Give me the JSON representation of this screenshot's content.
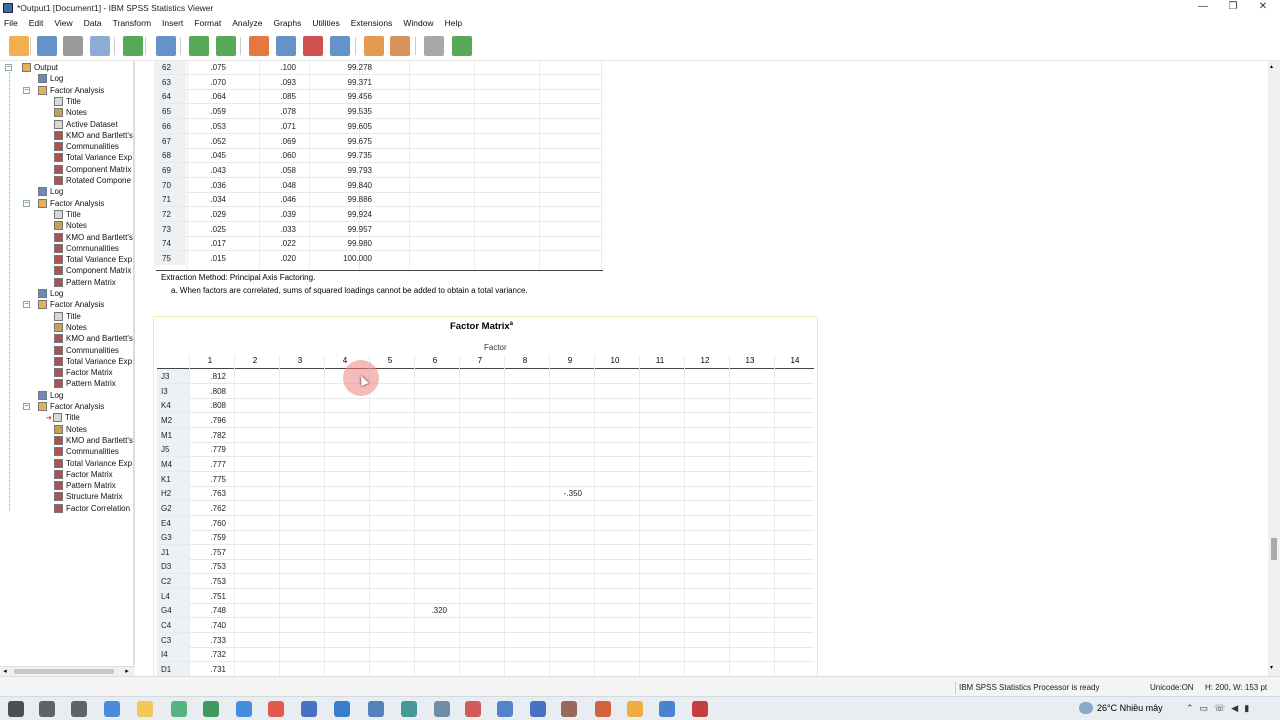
{
  "window": {
    "title": "*Output1 [Document1] - IBM SPSS Statistics Viewer",
    "minimize": "—",
    "restore": "❐",
    "close": "✕"
  },
  "menu": [
    "File",
    "Edit",
    "View",
    "Data",
    "Transform",
    "Insert",
    "Format",
    "Analyze",
    "Graphs",
    "Utilities",
    "Extensions",
    "Window",
    "Help"
  ],
  "toolbar": [
    "open-icon",
    "save-icon",
    "print-icon",
    "print-preview-icon",
    "export-icon",
    "recall-dialog-icon",
    "undo-icon",
    "redo-icon",
    "goto-data-icon",
    "goto-case-icon",
    "goto-variable-icon",
    "variables-icon",
    "insert-output-icon",
    "insert-item-icon",
    "disabled-icon",
    "add-icon"
  ],
  "tree": [
    {
      "label": "Output",
      "level": 0,
      "icon": "book"
    },
    {
      "label": "Log",
      "level": 1,
      "icon": "log"
    },
    {
      "label": "Factor Analysis",
      "level": 1,
      "icon": "book",
      "exp": "−"
    },
    {
      "label": "Title",
      "level": 2,
      "icon": "text"
    },
    {
      "label": "Notes",
      "level": 2,
      "icon": "note"
    },
    {
      "label": "Active Dataset",
      "level": 2,
      "icon": "text"
    },
    {
      "label": "KMO and Bartlett's",
      "level": 2,
      "icon": "table"
    },
    {
      "label": "Communalities",
      "level": 2,
      "icon": "table"
    },
    {
      "label": "Total Variance Exp",
      "level": 2,
      "icon": "table"
    },
    {
      "label": "Component Matrix",
      "level": 2,
      "icon": "table"
    },
    {
      "label": "Rotated Compone",
      "level": 2,
      "icon": "table"
    },
    {
      "label": "Log",
      "level": 1,
      "icon": "log"
    },
    {
      "label": "Factor Analysis",
      "level": 1,
      "icon": "book",
      "exp": "−"
    },
    {
      "label": "Title",
      "level": 2,
      "icon": "text"
    },
    {
      "label": "Notes",
      "level": 2,
      "icon": "note"
    },
    {
      "label": "KMO and Bartlett's",
      "level": 2,
      "icon": "table"
    },
    {
      "label": "Communalities",
      "level": 2,
      "icon": "table"
    },
    {
      "label": "Total Variance Exp",
      "level": 2,
      "icon": "table"
    },
    {
      "label": "Component Matrix",
      "level": 2,
      "icon": "table"
    },
    {
      "label": "Pattern Matrix",
      "level": 2,
      "icon": "table"
    },
    {
      "label": "Log",
      "level": 1,
      "icon": "log"
    },
    {
      "label": "Factor Analysis",
      "level": 1,
      "icon": "book",
      "exp": "−"
    },
    {
      "label": "Title",
      "level": 2,
      "icon": "text"
    },
    {
      "label": "Notes",
      "level": 2,
      "icon": "note"
    },
    {
      "label": "KMO and Bartlett's",
      "level": 2,
      "icon": "table"
    },
    {
      "label": "Communalities",
      "level": 2,
      "icon": "table"
    },
    {
      "label": "Total Variance Exp",
      "level": 2,
      "icon": "table"
    },
    {
      "label": "Factor Matrix",
      "level": 2,
      "icon": "table"
    },
    {
      "label": "Pattern Matrix",
      "level": 2,
      "icon": "table"
    },
    {
      "label": "Log",
      "level": 1,
      "icon": "log"
    },
    {
      "label": "Factor Analysis",
      "level": 1,
      "icon": "book",
      "exp": "−"
    },
    {
      "label": "Title",
      "level": 2,
      "icon": "text",
      "arrow": "➔"
    },
    {
      "label": "Notes",
      "level": 2,
      "icon": "note"
    },
    {
      "label": "KMO and Bartlett's",
      "level": 2,
      "icon": "table"
    },
    {
      "label": "Communalities",
      "level": 2,
      "icon": "table"
    },
    {
      "label": "Total Variance Exp",
      "level": 2,
      "icon": "table"
    },
    {
      "label": "Factor Matrix",
      "level": 2,
      "icon": "table"
    },
    {
      "label": "Pattern Matrix",
      "level": 2,
      "icon": "table"
    },
    {
      "label": "Structure Matrix",
      "level": 2,
      "icon": "table"
    },
    {
      "label": "Factor Correlation",
      "level": 2,
      "icon": "table"
    }
  ],
  "variance_rows": [
    [
      "62",
      ".075",
      ".100",
      "99.278"
    ],
    [
      "63",
      ".070",
      ".093",
      "99.371"
    ],
    [
      "64",
      ".064",
      ".085",
      "99.456"
    ],
    [
      "65",
      ".059",
      ".078",
      "99.535"
    ],
    [
      "66",
      ".053",
      ".071",
      "99.605"
    ],
    [
      "67",
      ".052",
      ".069",
      "99.675"
    ],
    [
      "68",
      ".045",
      ".060",
      "99.735"
    ],
    [
      "69",
      ".043",
      ".058",
      "99.793"
    ],
    [
      "70",
      ".036",
      ".048",
      "99.840"
    ],
    [
      "71",
      ".034",
      ".046",
      "99.886"
    ],
    [
      "72",
      ".029",
      ".039",
      "99.924"
    ],
    [
      "73",
      ".025",
      ".033",
      "99.957"
    ],
    [
      "74",
      ".017",
      ".022",
      "99.980"
    ],
    [
      "75",
      ".015",
      ".020",
      "100.000"
    ]
  ],
  "variance_footnote1": "Extraction Method: Principal Axis Factoring.",
  "variance_footnote2": "a. When factors are correlated, sums of squared loadings cannot be added to obtain a total variance.",
  "factor_matrix": {
    "title": "Factor Matrix",
    "title_sup": "a",
    "factor_header": "Factor",
    "columns": [
      "1",
      "2",
      "3",
      "4",
      "5",
      "6",
      "7",
      "8",
      "9",
      "10",
      "11",
      "12",
      "13",
      "14"
    ],
    "rows": [
      {
        "label": "J3",
        "c1": ".812"
      },
      {
        "label": "I3",
        "c1": ".808"
      },
      {
        "label": "K4",
        "c1": ".808"
      },
      {
        "label": "M2",
        "c1": ".796"
      },
      {
        "label": "M1",
        "c1": ".782"
      },
      {
        "label": "J5",
        "c1": ".779"
      },
      {
        "label": "M4",
        "c1": ".777"
      },
      {
        "label": "K1",
        "c1": ".775"
      },
      {
        "label": "H2",
        "c1": ".763",
        "other": {
          "col": 9,
          "val": "-.350"
        }
      },
      {
        "label": "G2",
        "c1": ".762"
      },
      {
        "label": "E4",
        "c1": ".760"
      },
      {
        "label": "G3",
        "c1": ".759"
      },
      {
        "label": "J1",
        "c1": ".757"
      },
      {
        "label": "D3",
        "c1": ".753"
      },
      {
        "label": "C2",
        "c1": ".753"
      },
      {
        "label": "L4",
        "c1": ".751"
      },
      {
        "label": "G4",
        "c1": ".748",
        "other": {
          "col": 6,
          "val": ".320"
        }
      },
      {
        "label": "C4",
        "c1": ".740"
      },
      {
        "label": "C3",
        "c1": ".733"
      },
      {
        "label": "I4",
        "c1": ".732"
      },
      {
        "label": "D1",
        "c1": ".731"
      }
    ]
  },
  "status": {
    "processor": "IBM SPSS Statistics Processor is ready",
    "unicode": "Unicode:ON",
    "dims": "H: 200, W: 153 pt"
  },
  "taskbar": {
    "weather": "26°C  Nhiều mây",
    "apps": [
      "start-icon",
      "search-icon",
      "task-view-icon",
      "edge-icon",
      "explorer-icon",
      "chrome-alt-icon",
      "excel-icon",
      "zalo-icon",
      "chrome-icon",
      "word-icon",
      "settings-icon",
      "spss-icon",
      "dots-icon",
      "paint-icon",
      "zoom-alt-icon",
      "vscode-icon",
      "word2-icon",
      "spss2-icon",
      "ppt-icon",
      "app-icon",
      "zoom-icon",
      "record-icon"
    ]
  },
  "colors": {
    "accent": "#3a6ea5",
    "table_border": "#f3ecb0",
    "cursor_highlight": "#f1a5a5"
  }
}
